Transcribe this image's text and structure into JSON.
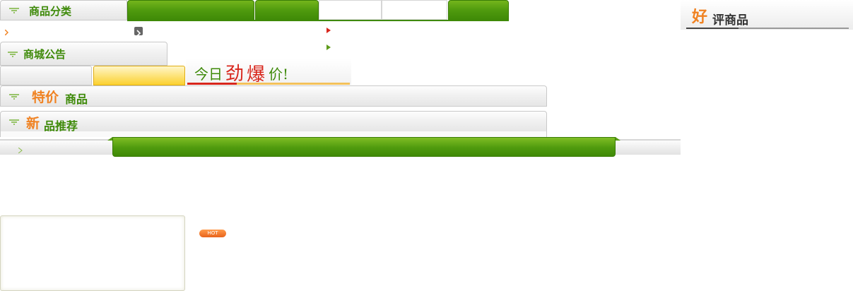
{
  "category": {
    "title": "商品分类"
  },
  "announce": {
    "title": "商城公告"
  },
  "today_banner": {
    "prefix": "今日",
    "big1": "劲",
    "big2": "爆",
    "suffix": "价!"
  },
  "specials": {
    "highlight": "特价",
    "rest": "商品"
  },
  "newitems": {
    "highlight": "新",
    "rest": "品推荐"
  },
  "good": {
    "highlight": "好",
    "rest": "评商品"
  },
  "hot_badge": {
    "label": "HOT"
  },
  "colors": {
    "brand_green": "#3e8a09",
    "accent_orange": "#f08222",
    "banner_red": "#d8261c",
    "tab_yellow": "#fbd12f"
  },
  "icons": {
    "header": "green-arrow-icon",
    "small_arrow": "chevron-right-icon",
    "play": "triangle-right-icon"
  }
}
